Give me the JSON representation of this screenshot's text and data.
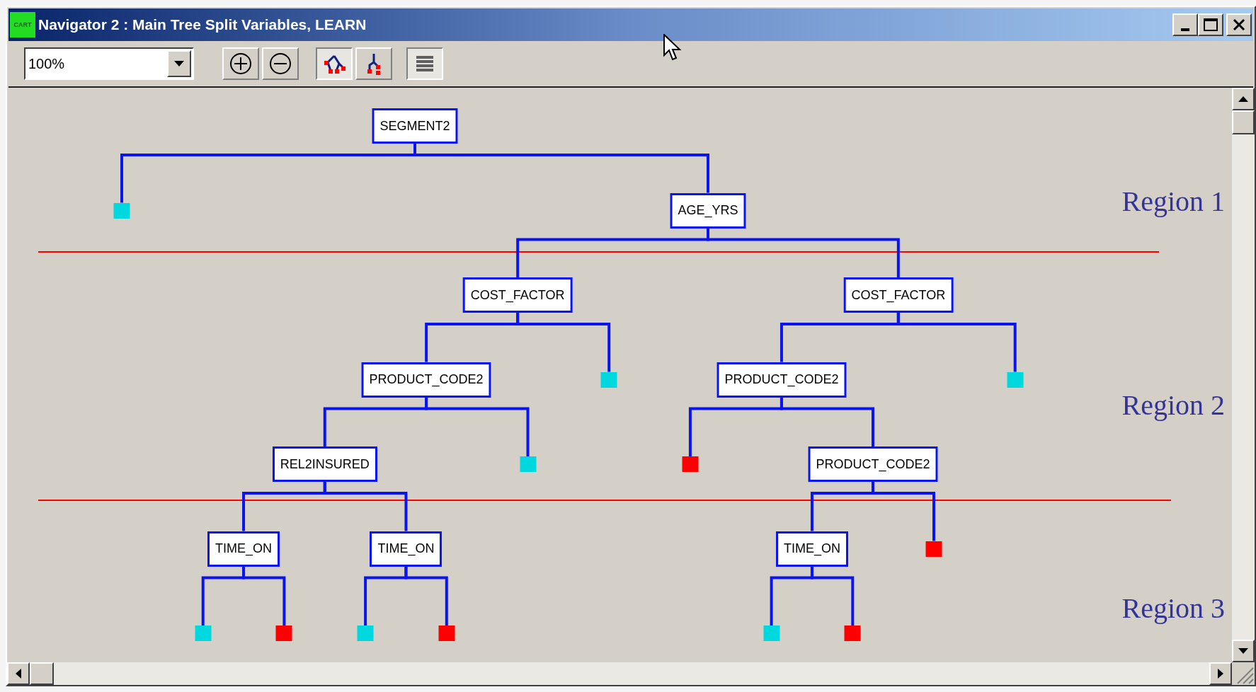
{
  "window": {
    "title": "Navigator 2 : Main Tree Split Variables, LEARN",
    "app_icon_text": "CART"
  },
  "toolbar": {
    "zoom": "100%",
    "view_buttons": [
      {
        "pressed": true
      },
      {
        "pressed": false
      }
    ],
    "list_button": {
      "pressed": true
    }
  },
  "tree": {
    "kind": "split",
    "label": "SEGMENT2",
    "children": [
      {
        "kind": "terminal",
        "color": "#00d8e0"
      },
      {
        "kind": "split",
        "label": "AGE_YRS",
        "children": [
          {
            "kind": "split",
            "label": "COST_FACTOR",
            "children": [
              {
                "kind": "split",
                "label": "PRODUCT_CODE2",
                "children": [
                  {
                    "kind": "split",
                    "label": "REL2INSURED",
                    "children": [
                      {
                        "kind": "split",
                        "label": "TIME_ON",
                        "children": [
                          {
                            "kind": "terminal",
                            "color": "#00d8e0"
                          },
                          {
                            "kind": "terminal",
                            "color": "#ff0000"
                          }
                        ]
                      },
                      {
                        "kind": "split",
                        "label": "TIME_ON",
                        "children": [
                          {
                            "kind": "terminal",
                            "color": "#00d8e0"
                          },
                          {
                            "kind": "terminal",
                            "color": "#ff0000"
                          }
                        ]
                      }
                    ]
                  },
                  {
                    "kind": "terminal",
                    "color": "#00d8e0"
                  }
                ]
              },
              {
                "kind": "terminal",
                "color": "#00d8e0"
              }
            ]
          },
          {
            "kind": "split",
            "label": "COST_FACTOR",
            "children": [
              {
                "kind": "split",
                "label": "PRODUCT_CODE2",
                "children": [
                  {
                    "kind": "terminal",
                    "color": "#ff0000"
                  },
                  {
                    "kind": "split",
                    "label": "PRODUCT_CODE2",
                    "children": [
                      {
                        "kind": "split",
                        "label": "TIME_ON",
                        "children": [
                          {
                            "kind": "terminal",
                            "color": "#00d8e0"
                          },
                          {
                            "kind": "terminal",
                            "color": "#ff0000"
                          }
                        ]
                      },
                      {
                        "kind": "terminal",
                        "color": "#ff0000"
                      }
                    ]
                  }
                ]
              },
              {
                "kind": "terminal",
                "color": "#00d8e0"
              }
            ]
          }
        ]
      }
    ]
  },
  "region_labels": [
    "Region 1",
    "Region 2",
    "Region 3"
  ]
}
